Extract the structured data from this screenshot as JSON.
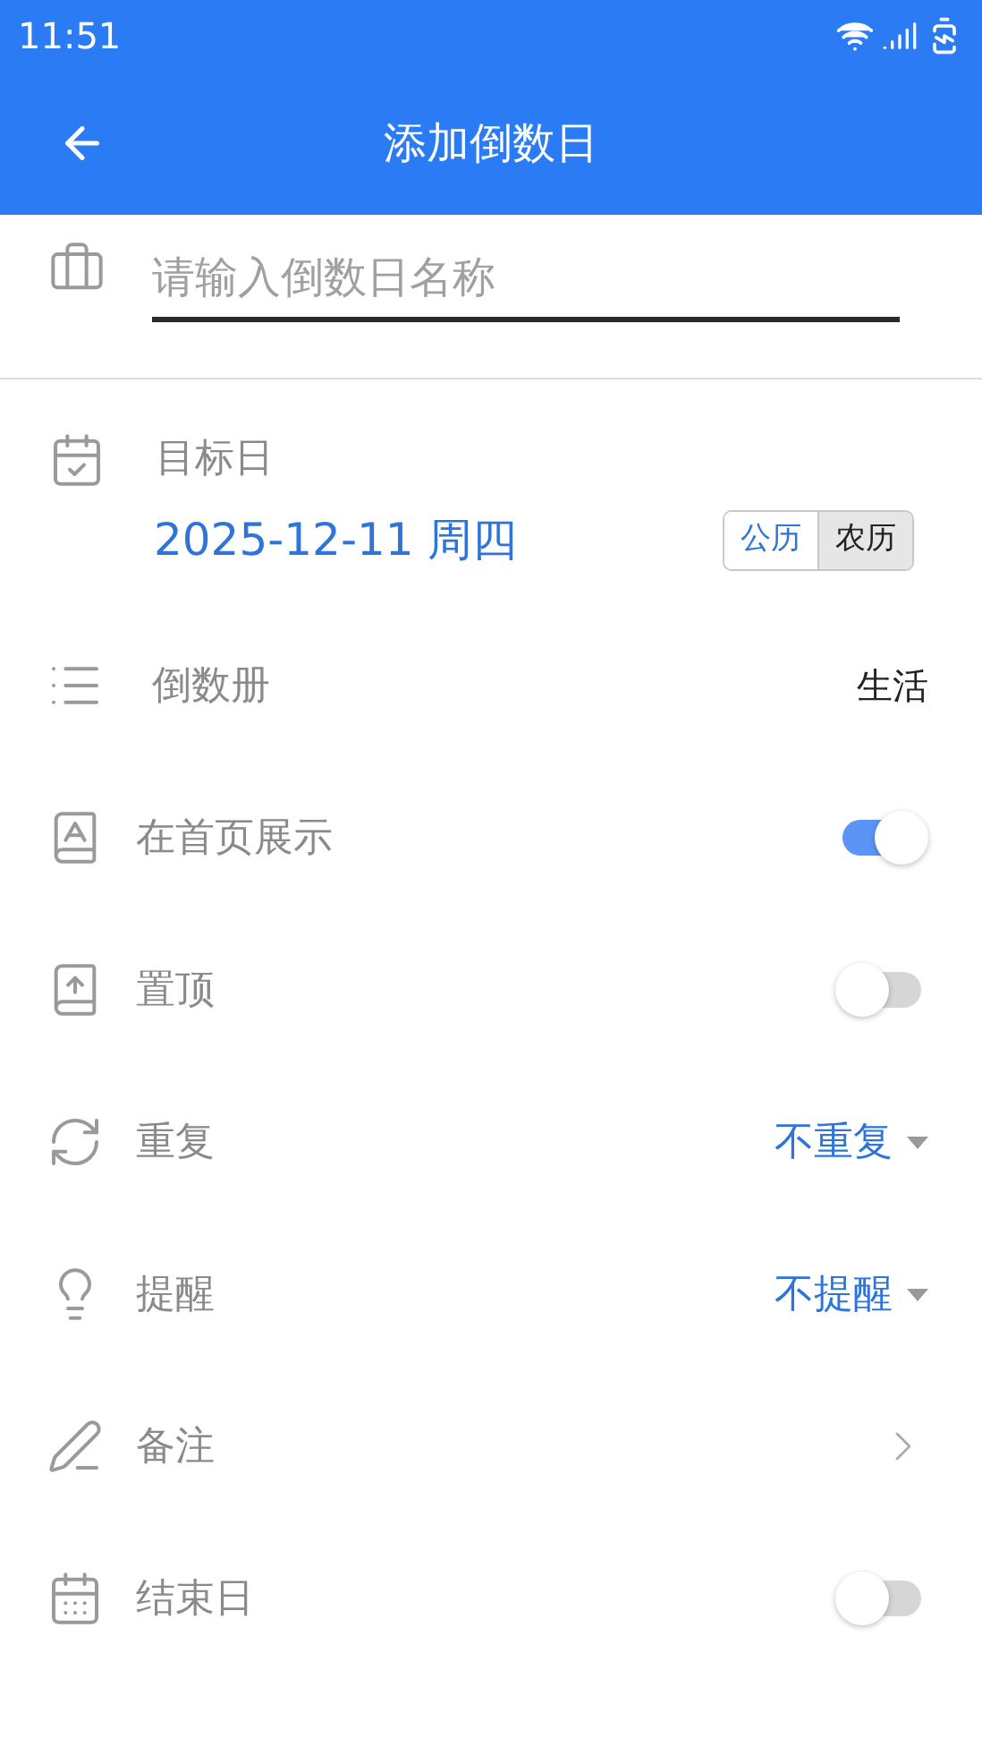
{
  "status_bar": {
    "time": "11:51"
  },
  "app_bar": {
    "title": "添加倒数日"
  },
  "name_field": {
    "placeholder": "请输入倒数日名称"
  },
  "target_date": {
    "label": "目标日",
    "value": "2025-12-11 周四",
    "calendars": [
      {
        "label": "公历",
        "selected": true
      },
      {
        "label": "农历",
        "selected": false
      }
    ]
  },
  "rows": [
    {
      "kind": "value",
      "label": "倒数册",
      "value": "生活"
    },
    {
      "kind": "toggle",
      "label": "在首页展示",
      "on": true
    },
    {
      "kind": "toggle",
      "label": "置顶",
      "on": false
    },
    {
      "kind": "dropdown",
      "label": "重复",
      "value": "不重复"
    },
    {
      "kind": "dropdown",
      "label": "提醒",
      "value": "不提醒"
    },
    {
      "kind": "link",
      "label": "备注"
    },
    {
      "kind": "toggle",
      "label": "结束日",
      "on": false
    }
  ]
}
